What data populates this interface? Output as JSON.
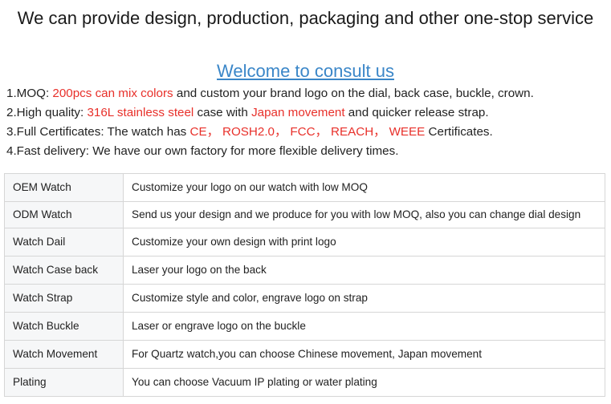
{
  "header": {
    "headline": "We can provide design, production, packaging and other one-stop service",
    "consult_link": "Welcome to consult us"
  },
  "points": [
    {
      "parts": [
        {
          "text": "1.MOQ: ",
          "red": false
        },
        {
          "text": "200pcs can mix colors",
          "red": true
        },
        {
          "text": " and custom your brand logo on the dial, back case, buckle, crown.",
          "red": false
        }
      ]
    },
    {
      "parts": [
        {
          "text": "2.High quality: ",
          "red": false
        },
        {
          "text": "316L stainless steel",
          "red": true
        },
        {
          "text": " case with ",
          "red": false
        },
        {
          "text": "Japan movement",
          "red": true
        },
        {
          "text": " and quicker release strap.",
          "red": false
        }
      ]
    },
    {
      "parts": [
        {
          "text": "3.Full Certificates: The watch has ",
          "red": false
        },
        {
          "text": "CE， ROSH2.0， FCC， REACH， WEEE",
          "red": true
        },
        {
          "text": " Certificates.",
          "red": false
        }
      ]
    },
    {
      "parts": [
        {
          "text": "4.Fast delivery: We have our own factory for more flexible delivery times.",
          "red": false
        }
      ]
    }
  ],
  "spec_table": [
    {
      "key": "OEM Watch",
      "value": "Customize your logo on our watch with low MOQ"
    },
    {
      "key": "ODM Watch",
      "value": "Send us your design and we produce for you with low MOQ, also you can change dial design"
    },
    {
      "key": "Watch Dail",
      "value": "Customize your own design with print logo"
    },
    {
      "key": "Watch Case back",
      "value": "Laser your logo on the back"
    },
    {
      "key": "Watch Strap",
      "value": "Customize style and color, engrave logo on strap"
    },
    {
      "key": "Watch Buckle",
      "value": "Laser or engrave logo on the buckle"
    },
    {
      "key": "Watch Movement",
      "value": "For Quartz watch,you can choose Chinese movement, Japan movement"
    },
    {
      "key": "Plating",
      "value": "You can choose Vacuum IP plating or water plating"
    }
  ],
  "colors": {
    "highlight_red": "#e8302a",
    "link_blue": "#3a86c8",
    "key_cell_bg": "#f6f7f8",
    "border": "#d6d6d6"
  }
}
